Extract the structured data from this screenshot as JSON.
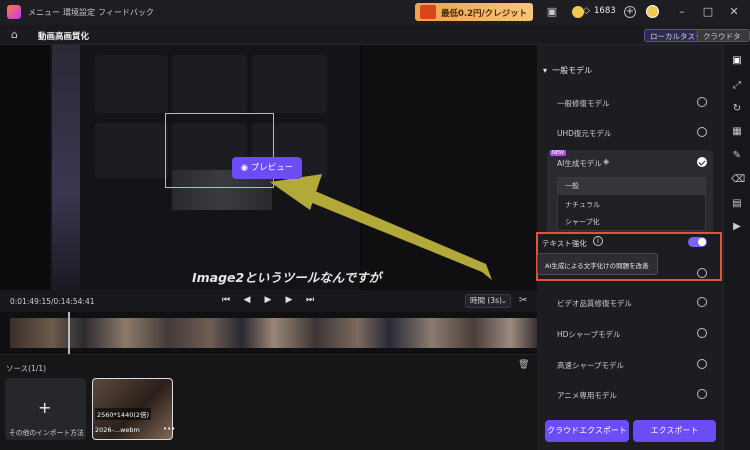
{
  "titlebar": {
    "menu": [
      "メニュー",
      "環境設定",
      "フィードバック"
    ],
    "promo_text": "最低0.2円/クレジット",
    "credits": "1683"
  },
  "subbar": {
    "title": "動画高画質化",
    "local_task": "ローカルタスク",
    "cloud_task": "クラウドタスク"
  },
  "preview": {
    "button_label": "プレビュー",
    "subtitle": "Image2というツールなんですが"
  },
  "playback": {
    "timecode": "0:01:49:15/0:14:54:41",
    "interval": "時間 (3s)"
  },
  "sources": {
    "label": "ソース(1/1)",
    "import_label": "その他のインポート方法",
    "clip_resolution": "2560*1440(2倍)",
    "clip_name": "2026-...webm"
  },
  "panel": {
    "group_title": "一般モデル",
    "models": [
      {
        "label": "一般修復モデル",
        "checked": false
      },
      {
        "label": "UHD復元モデル",
        "checked": false
      },
      {
        "label": "AI生成モデル",
        "checked": true,
        "badge": "NEW"
      },
      {
        "label": "ビデオ品質修復モデル",
        "checked": false
      },
      {
        "label": "HDシャープモデル",
        "checked": false
      },
      {
        "label": "高速シャープモデル",
        "checked": false
      },
      {
        "label": "アニメ専用モデル",
        "checked": false
      }
    ],
    "ai_options": [
      "一般",
      "ナチュラル",
      "シャープ化"
    ],
    "text_enhance_label": "テキスト強化",
    "text_enhance_on": true,
    "tooltip": "AI生成による文字化けの問題を改善",
    "cloud_export": "クラウドエクスポート",
    "export": "エクスポート"
  },
  "colors": {
    "accent": "#6c4cf5",
    "highlight_border": "#e2533c",
    "arrow": "#b3a93a"
  }
}
